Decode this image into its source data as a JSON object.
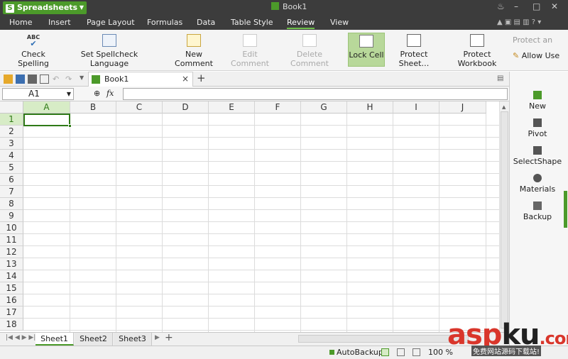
{
  "app": {
    "name": "Spreadsheets",
    "doc_title": "Book1"
  },
  "window_controls": {
    "skin": "♨",
    "min": "–",
    "max": "□",
    "close": "✕"
  },
  "menu": [
    "Home",
    "Insert",
    "Page Layout",
    "Formulas",
    "Data",
    "Table Style",
    "Review",
    "View"
  ],
  "menu_active": "Review",
  "ribbon": {
    "check_spelling": "Check Spelling",
    "spellcheck_language": "Set Spellcheck Language",
    "new_comment": "New Comment",
    "edit_comment": "Edit Comment",
    "delete_comment": "Delete Comment",
    "lock_cell": "Lock Cell",
    "protect_sheet": "Protect Sheet…",
    "protect_workbook": "Protect Workbook",
    "protect_an": "Protect an",
    "allow_users": "Allow Use",
    "abc": "ABC"
  },
  "tabs": {
    "doc_tab": "Book1",
    "close": "×",
    "add": "+"
  },
  "formula_bar": {
    "name_box": "A1",
    "fx": "fx",
    "value": ""
  },
  "columns": [
    "A",
    "B",
    "C",
    "D",
    "E",
    "F",
    "G",
    "H",
    "I",
    "J"
  ],
  "rows": [
    "1",
    "2",
    "3",
    "4",
    "5",
    "6",
    "7",
    "8",
    "9",
    "10",
    "11",
    "12",
    "13",
    "14",
    "15",
    "16",
    "17",
    "18"
  ],
  "selected_cell": "A1",
  "sheets": [
    "Sheet1",
    "Sheet2",
    "Sheet3"
  ],
  "active_sheet": "Sheet1",
  "sidebar": [
    "New",
    "Pivot",
    "SelectShape",
    "Materials",
    "Backup"
  ],
  "status": {
    "autobackup": "AutoBackup",
    "zoom": "100 %"
  },
  "watermark": {
    "main_asp": "asp",
    "main_ku": "ku",
    "suffix": ".com",
    "sub": "免费网站源码下载站!"
  },
  "colors": {
    "accent": "#4c9a2a",
    "titlebar": "#3c3c3c",
    "selected_header": "#d7ecc6"
  }
}
